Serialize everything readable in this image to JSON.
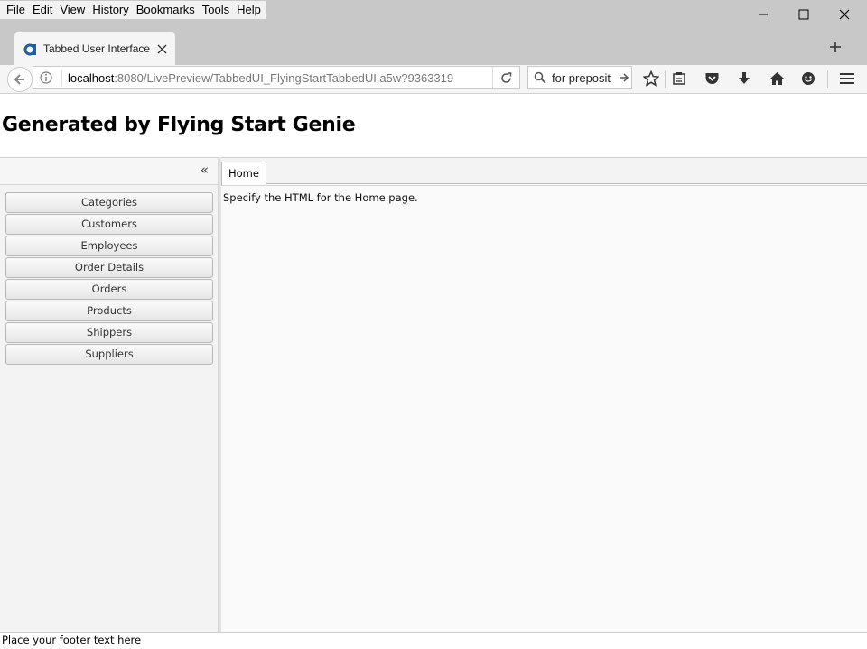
{
  "menu": [
    "File",
    "Edit",
    "View",
    "History",
    "Bookmarks",
    "Tools",
    "Help"
  ],
  "browser": {
    "tab_title": "Tabbed User Interface",
    "url_host": "localhost",
    "url_rest": ":8080/LivePreview/TabbedUI_FlyingStartTabbedUI.a5w?9363319",
    "search_value": "for preposit"
  },
  "page": {
    "title": "Generated by Flying Start Genie",
    "collapse_label": "«",
    "nav_items": [
      "Categories",
      "Customers",
      "Employees",
      "Order Details",
      "Orders",
      "Products",
      "Shippers",
      "Suppliers"
    ],
    "active_tab": "Home",
    "content_text": "Specify the HTML for the Home page.",
    "footer_text": "Place your footer text here"
  },
  "colors": {
    "chrome": "#c8c8c8",
    "toolbar": "#f5f5f5",
    "sidebar": "#f3f3f3"
  }
}
